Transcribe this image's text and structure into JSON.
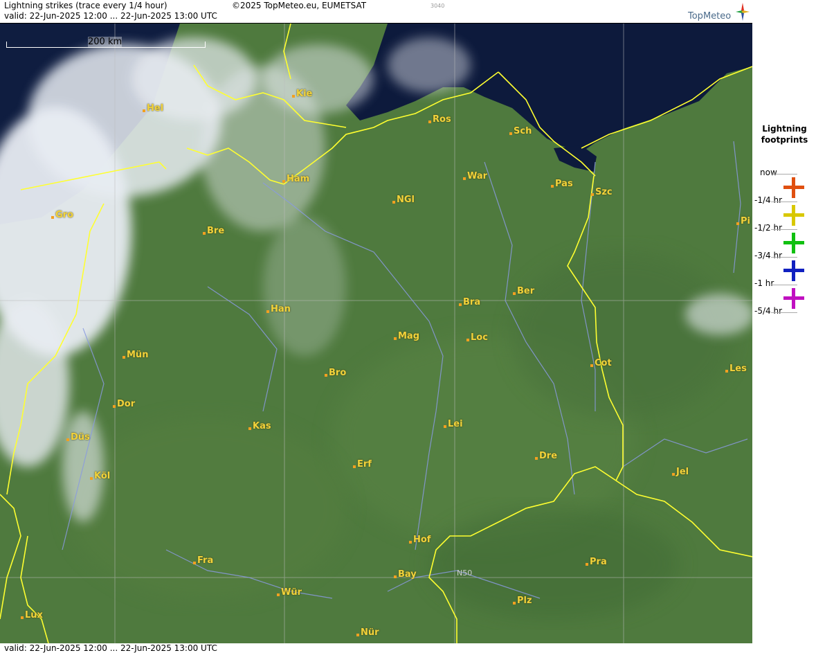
{
  "header": {
    "title": "Lightning strikes (trace every 1/4 hour)",
    "valid": "valid:  22-Jun-2025 12:00 ... 22-Jun-2025 13:00 UTC",
    "copyright": "©2025 TopMeteo.eu, EUMETSAT",
    "code": "3040",
    "logo_text": "TopMeteo"
  },
  "footer": {
    "valid": "valid:  22-Jun-2025 12:00 ... 22-Jun-2025 13:00 UTC"
  },
  "map": {
    "scale_label": "200 km",
    "grid_label": "N50",
    "cities": [
      "Hel",
      "Kie",
      "Ros",
      "Sch",
      "Ham",
      "War",
      "Pas",
      "Szc",
      "Gro",
      "NGl",
      "Bre",
      "Pi",
      "Ber",
      "Bra",
      "Han",
      "Mag",
      "Loc",
      "Cot",
      "Les",
      "Mün",
      "Bro",
      "Dor",
      "Kas",
      "Lei",
      "Düs",
      "Erf",
      "Dre",
      "Jel",
      "Köl",
      "Hof",
      "Fra",
      "Bay",
      "Pra",
      "Wür",
      "Plz",
      "Lux",
      "Nür"
    ]
  },
  "legend": {
    "title_line1": "Lightning",
    "title_line2": "footprints",
    "items": [
      {
        "label": "now",
        "color": "#e05010"
      },
      {
        "label": "-1/4 hr",
        "color": "#d8c800"
      },
      {
        "label": "-1/2 hr",
        "color": "#10c010"
      },
      {
        "label": "-3/4 hr",
        "color": "#1020c0"
      },
      {
        "label": "-1 hr",
        "color": "#c010c0"
      },
      {
        "label": "-5/4 hr",
        "color": ""
      }
    ]
  },
  "colors": {
    "border": "#ffff30",
    "river": "#8a9ae0",
    "sea": "#0d1a3c",
    "land": "#4f7a3e",
    "city_label": "#f2d23a"
  }
}
